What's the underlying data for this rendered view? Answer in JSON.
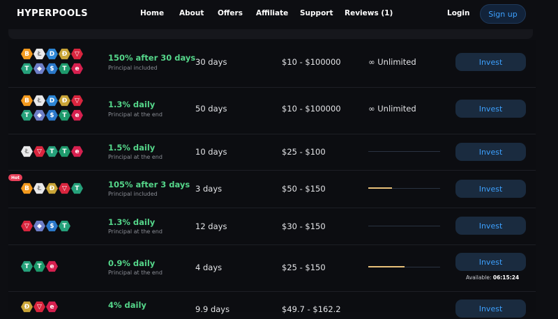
{
  "header": {
    "logo": "HYPERPOOLS",
    "nav": [
      "Home",
      "About",
      "Offers",
      "Affiliate",
      "Support",
      "Reviews (1)"
    ],
    "login": "Login",
    "signup": "Sign up"
  },
  "colors": {
    "accent": "#3da1ff",
    "rate_green": "#55d68a",
    "bar_fill": "#e8c17a",
    "hot": "#e8405a"
  },
  "plans": [
    {
      "rate": "150% after 30 days",
      "note": "Principal included",
      "days": "30 days",
      "amount": "$10 - $100000",
      "limit": "∞ Unlimited",
      "progress": null,
      "invest": "Invest",
      "coins": [
        "btc-icon",
        "ltc-icon",
        "dash-icon",
        "doge-icon",
        "trx-icon",
        "usdt-icon",
        "eth-icon",
        "usdc-icon",
        "trc20-icon",
        "e-coin-icon"
      ]
    },
    {
      "rate": "1.3% daily",
      "note": "Principal at the end",
      "days": "50 days",
      "amount": "$10 - $100000",
      "limit": "∞ Unlimited",
      "progress": null,
      "invest": "Invest",
      "coins": [
        "btc-icon",
        "ltc-icon",
        "dash-icon",
        "doge-icon",
        "trx-icon",
        "usdt-icon",
        "eth-icon",
        "usdc-icon",
        "trc20-icon",
        "e-coin-icon"
      ]
    },
    {
      "rate": "1.5% daily",
      "note": "Principal at the end",
      "days": "10 days",
      "amount": "$25 - $100",
      "limit": null,
      "progress": 0.0,
      "invest": "Invest",
      "coins": [
        "ltc-icon",
        "trx-icon",
        "usdt-icon",
        "trc20-icon",
        "e-coin-icon"
      ]
    },
    {
      "rate": "105% after 3 days",
      "note": "Principal included",
      "days": "3 days",
      "amount": "$50 - $150",
      "limit": null,
      "progress": 0.33,
      "invest": "Invest",
      "badge": "Hot",
      "coins": [
        "btc-icon",
        "ltc-icon",
        "doge-icon",
        "trx-icon",
        "usdt-icon"
      ]
    },
    {
      "rate": "1.3% daily",
      "note": "Principal at the end",
      "days": "12 days",
      "amount": "$30 - $150",
      "limit": null,
      "progress": 0.0,
      "invest": "Invest",
      "coins": [
        "trx-icon",
        "eth-icon",
        "usdc-icon",
        "usdt-icon"
      ]
    },
    {
      "rate": "0.9% daily",
      "note": "Principal at the end",
      "days": "4 days",
      "amount": "$25 - $150",
      "limit": null,
      "progress": 0.5,
      "invest": "Invest",
      "available_label": "Available:",
      "available_time": "06:15:24",
      "coins": [
        "usdt-icon",
        "trc20-icon",
        "e-coin-icon"
      ]
    },
    {
      "rate": "4% daily",
      "note": "",
      "days": "9.9 days",
      "amount": "$49.7 - $162.2",
      "limit": null,
      "progress": null,
      "invest": "Invest",
      "coins": [
        "doge-icon",
        "trx-icon",
        "e-coin-icon"
      ]
    }
  ]
}
